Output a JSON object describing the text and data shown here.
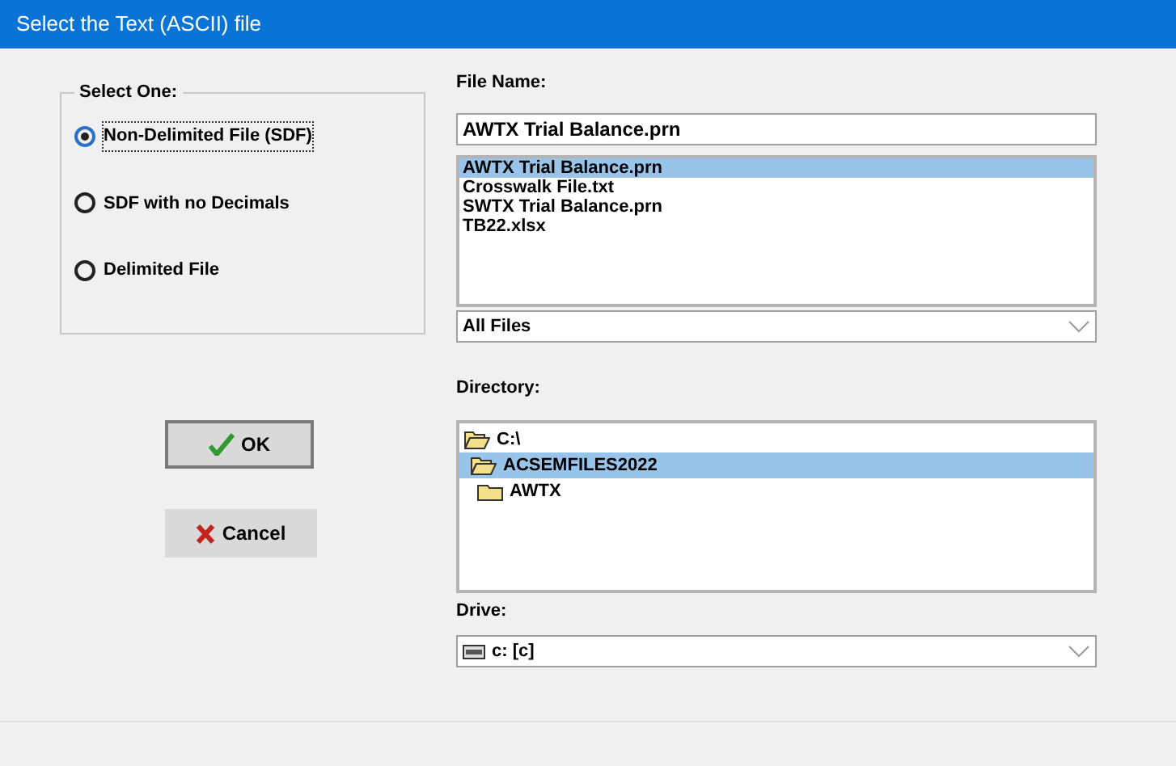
{
  "window": {
    "title": "Select the Text (ASCII) file"
  },
  "format_group": {
    "legend": "Select One:",
    "options": [
      {
        "label": "Non-Delimited File (SDF)",
        "selected": true
      },
      {
        "label": "SDF with no Decimals",
        "selected": false
      },
      {
        "label": "Delimited File",
        "selected": false
      }
    ]
  },
  "buttons": [
    {
      "kind": "ok",
      "label": "OK"
    },
    {
      "kind": "cancel",
      "label": "Cancel"
    }
  ],
  "file_name": {
    "label": "File Name:",
    "value": "AWTX Trial Balance.prn"
  },
  "files": [
    {
      "name": "AWTX Trial Balance.prn",
      "selected": true
    },
    {
      "name": "Crosswalk File.txt",
      "selected": false
    },
    {
      "name": "SWTX Trial Balance.prn",
      "selected": false
    },
    {
      "name": "TB22.xlsx",
      "selected": false
    }
  ],
  "file_type": {
    "value": "All Files"
  },
  "directory": {
    "label": "Directory:",
    "tree": [
      {
        "name": "C:\\",
        "selected": false,
        "children": [
          {
            "name": "ACSEMFILES2022",
            "selected": true,
            "children": [
              {
                "name": "AWTX",
                "selected": false
              }
            ]
          }
        ]
      }
    ]
  },
  "drive": {
    "label": "Drive:",
    "value": "c: [c]"
  }
}
